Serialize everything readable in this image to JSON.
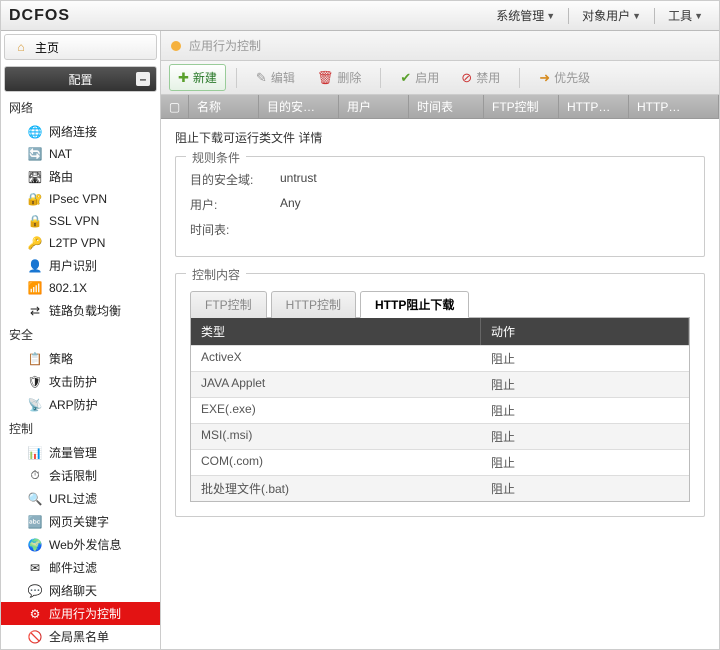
{
  "brand": "DCFOS",
  "topmenu": [
    "系统管理",
    "对象用户",
    "工具"
  ],
  "side": {
    "home": "主页",
    "config": "配置",
    "groups": [
      {
        "title": "网络",
        "items": [
          "网络连接",
          "NAT",
          "路由",
          "IPsec VPN",
          "SSL VPN",
          "L2TP VPN",
          "用户识别",
          "802.1X",
          "链路负载均衡"
        ]
      },
      {
        "title": "安全",
        "items": [
          "策略",
          "攻击防护",
          "ARP防护"
        ]
      },
      {
        "title": "控制",
        "items": [
          "流量管理",
          "会话限制",
          "URL过滤",
          "网页关键字",
          "Web外发信息",
          "邮件过滤",
          "网络聊天",
          "应用行为控制",
          "全局黑名单"
        ]
      }
    ],
    "activeGroup": 2,
    "activeItem": 7
  },
  "tab_title": "应用行为控制",
  "toolbar": {
    "new": "新建",
    "edit": "编辑",
    "delete": "删除",
    "enable": "启用",
    "disable": "禁用",
    "priority": "优先级"
  },
  "grid_cols": [
    "名称",
    "目的安…",
    "用户",
    "时间表",
    "FTP控制",
    "HTTP…",
    "HTTP…"
  ],
  "detail_title": "阻止下载可运行类文件 详情",
  "rule_legend": "规则条件",
  "rules": {
    "dst_zone_k": "目的安全域:",
    "dst_zone_v": "untrust",
    "user_k": "用户:",
    "user_v": "Any",
    "sched_k": "时间表:",
    "sched_v": ""
  },
  "ctrl_legend": "控制内容",
  "subtabs": [
    "FTP控制",
    "HTTP控制",
    "HTTP阻止下载"
  ],
  "active_subtab": 2,
  "table_head": [
    "类型",
    "动作"
  ],
  "rows": [
    {
      "t": "ActiveX",
      "a": "阻止"
    },
    {
      "t": "JAVA Applet",
      "a": "阻止"
    },
    {
      "t": "EXE(.exe)",
      "a": "阻止"
    },
    {
      "t": "MSI(.msi)",
      "a": "阻止"
    },
    {
      "t": "COM(.com)",
      "a": "阻止"
    },
    {
      "t": "批处理文件(.bat)",
      "a": "阻止"
    }
  ]
}
